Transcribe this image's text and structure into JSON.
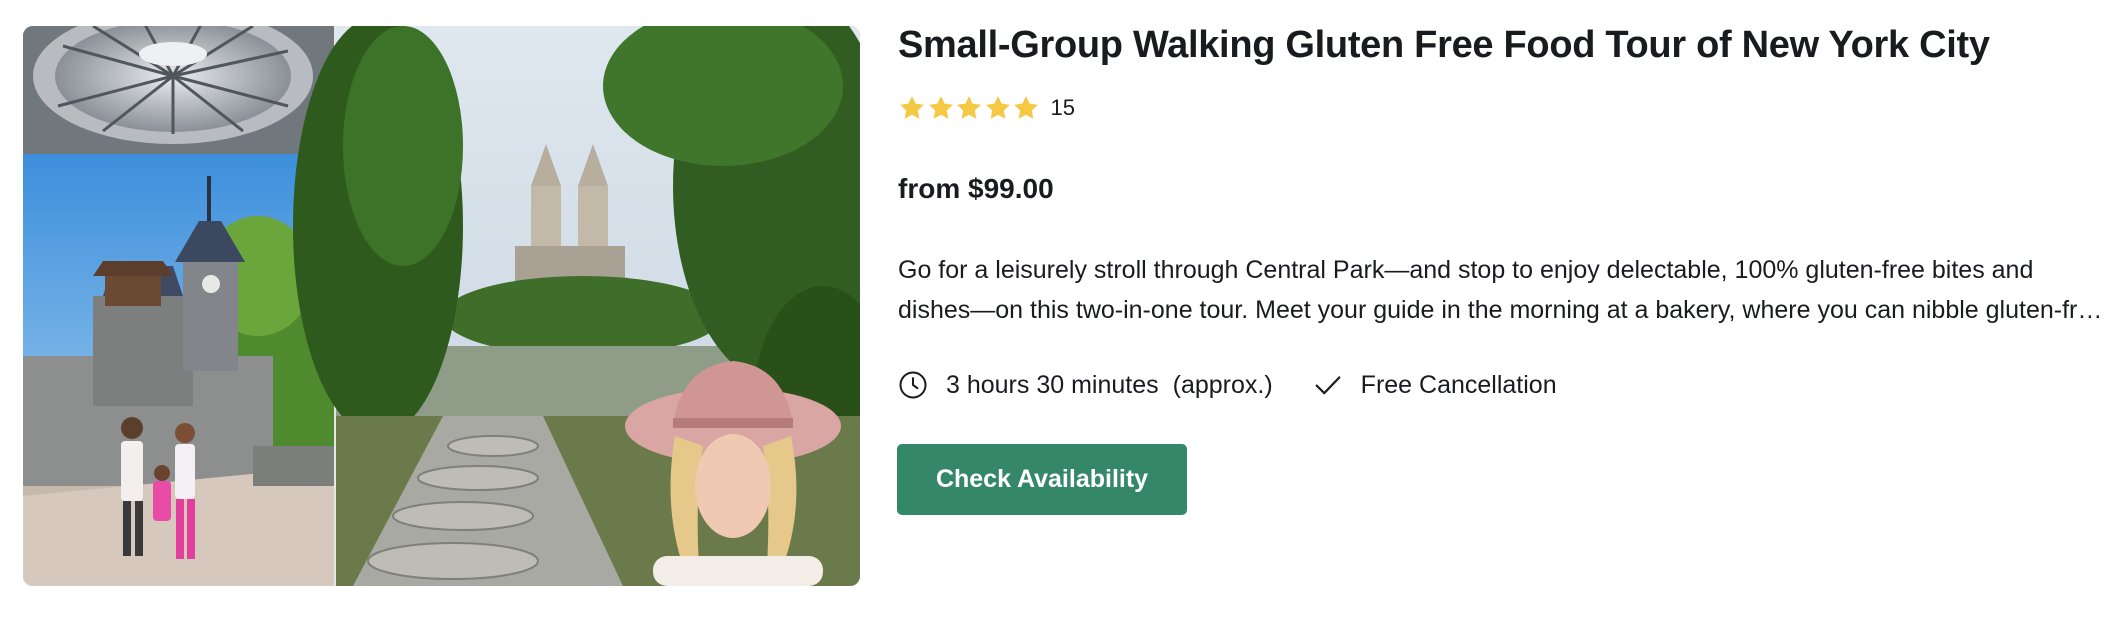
{
  "listing": {
    "title": "Small-Group Walking Gluten Free Food Tour of New York City",
    "rating": {
      "stars": 5,
      "max_stars": 5,
      "review_count": "15",
      "star_color": "#f6c945"
    },
    "price": "from $99.00",
    "description": "Go for a leisurely stroll through Central Park—and stop to enjoy delectable, 100% gluten-free bites and dishes—on this two-in-one tour. Meet your guide in the morning at a bakery, where you can nibble gluten-free pastries before heading into the park.",
    "duration": {
      "icon": "clock-icon",
      "label": "3 hours 30 minutes",
      "approx": "(approx.)"
    },
    "cancellation": {
      "icon": "checkmark-icon",
      "label": "Free Cancellation"
    },
    "cta_label": "Check Availability",
    "cta_color": "#35876a"
  }
}
